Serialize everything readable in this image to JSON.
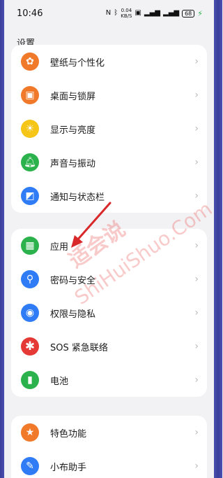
{
  "status": {
    "time": "10:46",
    "speed_value": "0.04",
    "speed_unit": "KB/S",
    "battery": "68"
  },
  "page": {
    "title": "设置"
  },
  "groups": [
    {
      "items": [
        {
          "label": "壁纸与个性化",
          "icon": "palette-icon",
          "color": "#f07a2a"
        },
        {
          "label": "桌面与锁屏",
          "icon": "image-icon",
          "color": "#f07a2a"
        },
        {
          "label": "显示与亮度",
          "icon": "sun-icon",
          "color": "#f5c518"
        },
        {
          "label": "声音与振动",
          "icon": "bell-icon",
          "color": "#2bb24c"
        },
        {
          "label": "通知与状态栏",
          "icon": "notification-icon",
          "color": "#2f7cf6"
        }
      ]
    },
    {
      "items": [
        {
          "label": "应用",
          "icon": "apps-grid-icon",
          "color": "#2bb24c"
        },
        {
          "label": "密码与安全",
          "icon": "key-icon",
          "color": "#2f7cf6"
        },
        {
          "label": "权限与隐私",
          "icon": "eye-shield-icon",
          "color": "#2f7cf6"
        },
        {
          "label": "SOS 紧急联络",
          "icon": "sos-asterisk-icon",
          "color": "#e53935"
        },
        {
          "label": "电池",
          "icon": "battery-icon",
          "color": "#2bb24c"
        }
      ]
    },
    {
      "items": [
        {
          "label": "特色功能",
          "icon": "star-icon",
          "color": "#f07a2a"
        },
        {
          "label": "小布助手",
          "icon": "assistant-icon",
          "color": "#2f7cf6"
        }
      ]
    }
  ],
  "watermark": {
    "cn": "适会说",
    "en": "ShiHuiShuo.Com"
  }
}
